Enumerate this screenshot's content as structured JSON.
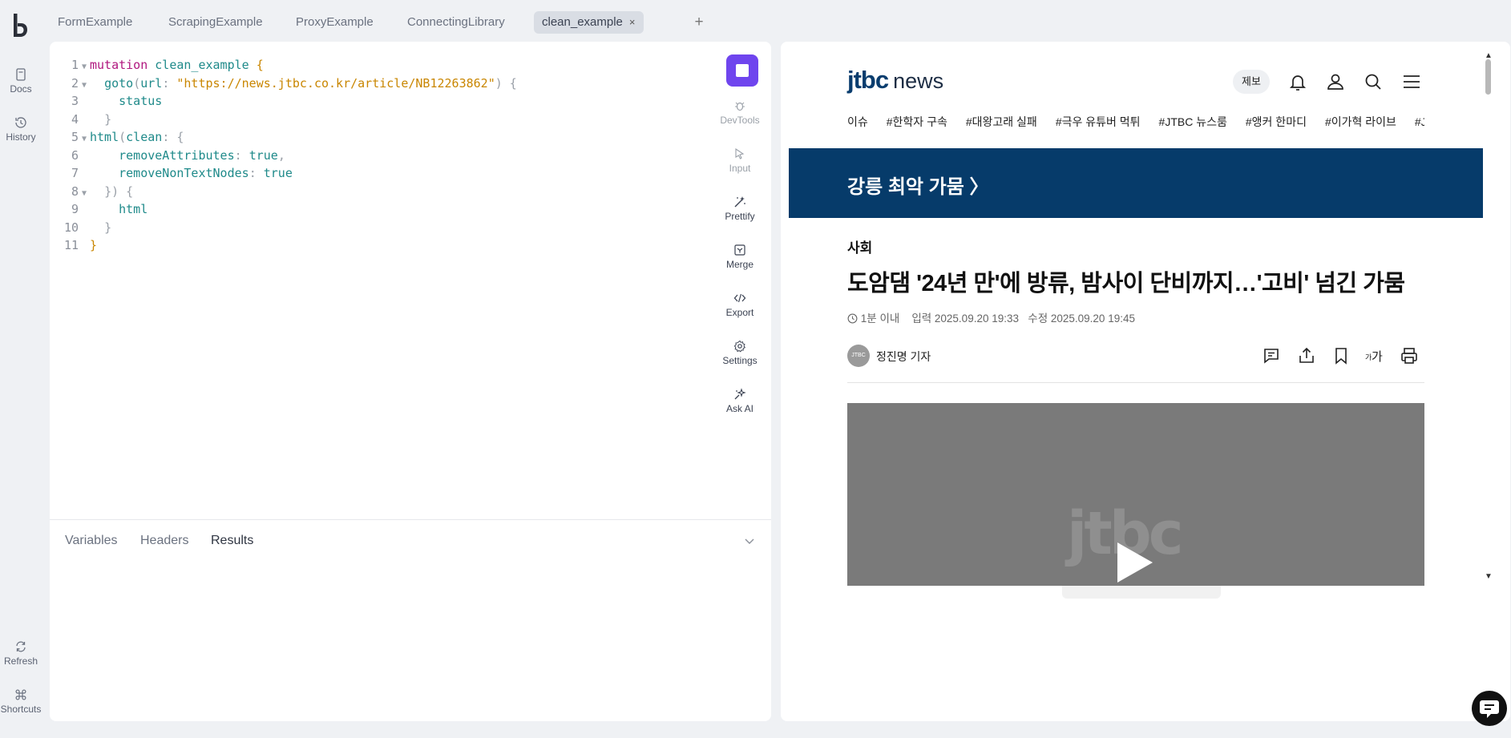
{
  "rail": {
    "items": [
      {
        "label": "Docs"
      },
      {
        "label": "History"
      },
      {
        "label": "Refresh"
      },
      {
        "label": "Shortcuts"
      }
    ]
  },
  "tabs": [
    {
      "label": "FormExample"
    },
    {
      "label": "ScrapingExample"
    },
    {
      "label": "ProxyExample"
    },
    {
      "label": "ConnectingLibrary"
    },
    {
      "label": "clean_example",
      "active": true,
      "close": "×"
    }
  ],
  "add_tab": "+",
  "editor": {
    "lines": [
      "1",
      "2",
      "3",
      "4",
      "5",
      "6",
      "7",
      "8",
      "9",
      "10",
      "11"
    ],
    "code": {
      "l1_kw": "mutation",
      "l1_name": "clean_example",
      "l1_brace": "{",
      "l2_fn": "goto",
      "l2_arg": "url",
      "l2_str": "\"https://news.jtbc.co.kr/article/NB12263862\"",
      "l2_end": "{",
      "l3": "status",
      "l4": "}",
      "l5_fn": "html",
      "l5_arg": "clean",
      "l5_brace": "{",
      "l6_key": "removeAttributes",
      "l6_val": "true",
      "l7_key": "removeNonTextNodes",
      "l7_val": "true",
      "l8": "}) {",
      "l9": "html",
      "l10": "}",
      "l11": "}"
    }
  },
  "tools": [
    {
      "label": "DevTools",
      "icon": "bug-icon",
      "enabled": false
    },
    {
      "label": "Input",
      "icon": "cursor-icon",
      "enabled": false
    },
    {
      "label": "Prettify",
      "icon": "magic-wand-icon",
      "enabled": true
    },
    {
      "label": "Merge",
      "icon": "merge-icon",
      "enabled": true
    },
    {
      "label": "Export",
      "icon": "code-icon",
      "enabled": true
    },
    {
      "label": "Settings",
      "icon": "gear-icon",
      "enabled": true
    },
    {
      "label": "Ask AI",
      "icon": "sparkle-icon",
      "enabled": true
    }
  ],
  "bottom_tabs": [
    {
      "label": "Variables"
    },
    {
      "label": "Headers"
    },
    {
      "label": "Results",
      "active": true
    }
  ],
  "browser": {
    "logo_main": "jtbc",
    "logo_news": "news",
    "tip_button": "제보",
    "topics": [
      "이슈",
      "#한학자 구속",
      "#대왕고래 실패",
      "#극우 유튜버 먹튀",
      "#JTBC 뉴스룸",
      "#앵커 한마디",
      "#이가혁 라이브",
      "#JTBC"
    ],
    "banner": "강릉 최악 가뭄 〉",
    "section": "사회",
    "headline": "도암댐 '24년 만'에 방류, 밤사이 단비까지…'고비' 넘긴 가뭄",
    "meta": {
      "read_time": "1분 이내",
      "posted": "입력 2025.09.20 19:33",
      "updated": "수정 2025.09.20 19:45"
    },
    "avatar_text": "JTBC",
    "reporter": "정진명 기자",
    "video_logo": "jtbc"
  },
  "colors": {
    "accent": "#6f45ee",
    "banner": "#063b6a",
    "keyword": "#b0177f",
    "identifier": "#1f8a8a",
    "string": "#c98600"
  }
}
